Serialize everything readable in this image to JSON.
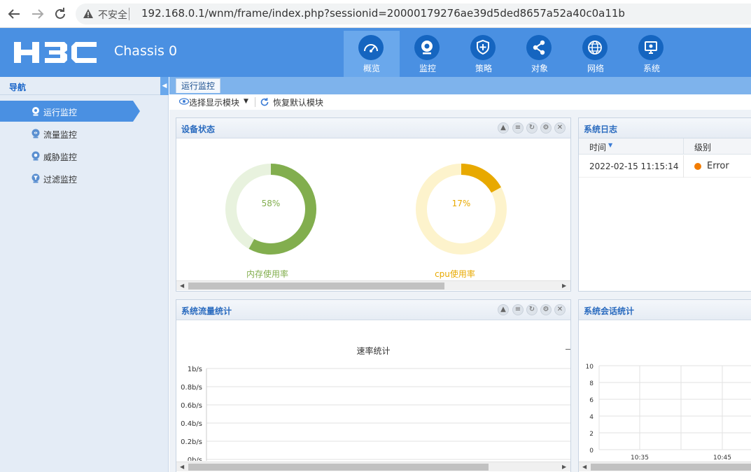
{
  "browser": {
    "back_icon": "back-arrow-icon",
    "forward_icon": "forward-arrow-icon",
    "reload_icon": "reload-icon",
    "insecure_label": "不安全",
    "url": "192.168.0.1/wnm/frame/index.php?sessionid=20000179276ae39d5ded8657a52a40c0a11b"
  },
  "header": {
    "logo_text": "H3C",
    "device_name": "Chassis 0",
    "tabs": [
      {
        "label": "概览",
        "icon": "speedometer-icon",
        "active": true
      },
      {
        "label": "监控",
        "icon": "webcam-icon",
        "active": false
      },
      {
        "label": "策略",
        "icon": "shield-icon",
        "active": false
      },
      {
        "label": "对象",
        "icon": "share-nodes-icon",
        "active": false
      },
      {
        "label": "网络",
        "icon": "globe-icon",
        "active": false
      },
      {
        "label": "系统",
        "icon": "monitor-icon",
        "active": false
      }
    ],
    "colors": {
      "header_bg": "#4a90e2",
      "tab_circle": "#1565c0",
      "active_tab": "#6aa8ec"
    }
  },
  "sidebar": {
    "title": "导航",
    "collapse_icon": "collapse-left-icon",
    "items": [
      {
        "label": "运行监控",
        "active": true
      },
      {
        "label": "流量监控",
        "active": false
      },
      {
        "label": "威胁监控",
        "active": false
      },
      {
        "label": "过滤监控",
        "active": false
      }
    ]
  },
  "content": {
    "tab_label": "运行监控",
    "toolbar": {
      "select_modules": "选择显示模块",
      "restore_modules": "恢复默认模块"
    }
  },
  "panels": {
    "device_status": {
      "title": "设备状态",
      "memory": {
        "percent_text": "58%",
        "value": 58,
        "label": "内存使用率",
        "color": "#82ae4e",
        "track": "#e8f2de"
      },
      "cpu": {
        "percent_text": "17%",
        "value": 17,
        "label": "cpu使用率",
        "color": "#e8a900",
        "track": "#fdf3cc"
      }
    },
    "system_log": {
      "title": "系统日志",
      "columns": [
        "时间",
        "级别"
      ],
      "rows": [
        {
          "time": "2022-02-15 11:15:14",
          "level": "Error",
          "level_color": "#f27c00"
        }
      ]
    },
    "traffic": {
      "title": "系统流量统计",
      "chart_title": "速率统计",
      "y_ticks": [
        "1b/s",
        "0.8b/s",
        "0.6b/s",
        "0.4b/s",
        "0.2b/s",
        "0b/s"
      ]
    },
    "sessions": {
      "title": "系统会话统计",
      "y_ticks": [
        "10",
        "8",
        "6",
        "4",
        "2",
        "0"
      ],
      "x_ticks": [
        "10:35",
        "10:45"
      ]
    }
  },
  "chart_data": [
    {
      "type": "pie",
      "title": "",
      "categories": [
        "内存使用率",
        "free"
      ],
      "values": [
        58,
        42
      ]
    },
    {
      "type": "pie",
      "title": "",
      "categories": [
        "cpu使用率",
        "free"
      ],
      "values": [
        17,
        83
      ]
    },
    {
      "type": "line",
      "title": "速率统计",
      "ylabel": "",
      "ylim": [
        0,
        1
      ],
      "y_ticks": [
        "0b/s",
        "0.2b/s",
        "0.4b/s",
        "0.6b/s",
        "0.8b/s",
        "1b/s"
      ],
      "series": []
    },
    {
      "type": "line",
      "title": "",
      "ylim": [
        0,
        10
      ],
      "x_ticks": [
        "10:35",
        "10:45"
      ],
      "series": []
    }
  ]
}
